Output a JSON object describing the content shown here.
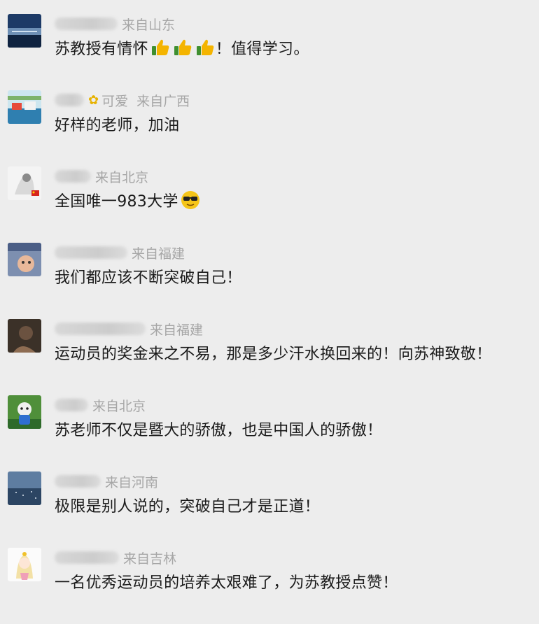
{
  "comments": [
    {
      "nickname": "",
      "location": "来自山东",
      "text": "苏教授有情怀",
      "suffix": "！值得学习。",
      "emoji": "thumbs-up-icon",
      "emoji_count": 3
    },
    {
      "nickname": "可爱",
      "location": "来自广西",
      "text": "好样的老师，加油",
      "badge": "sunflower-icon"
    },
    {
      "nickname": "",
      "location": "来自北京",
      "text": "全国唯一983大学",
      "emoji": "sunglasses-face-icon",
      "emoji_count": 1
    },
    {
      "nickname": "",
      "location": "来自福建",
      "text": "我们都应该不断突破自己！"
    },
    {
      "nickname": "",
      "location": "来自福建",
      "text": "运动员的奖金来之不易，那是多少汗水换回来的！向苏神致敬！"
    },
    {
      "nickname": "",
      "location": "来自北京",
      "text": "苏老师不仅是暨大的骄傲，也是中国人的骄傲！"
    },
    {
      "nickname": "",
      "location": "来自河南",
      "text": "极限是别人说的，突破自己才是正道！"
    },
    {
      "nickname": "",
      "location": "来自吉林",
      "text": "一名优秀运动员的培养太艰难了，为苏教授点赞！"
    }
  ],
  "colors": {
    "background": "#ededed",
    "text": "#1a1a1a",
    "meta": "#a6a6a6"
  }
}
